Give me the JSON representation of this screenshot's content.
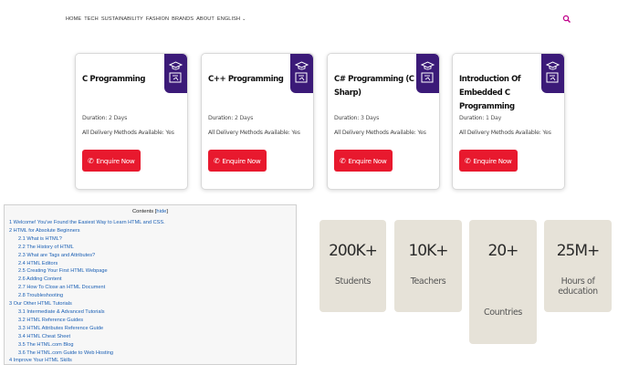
{
  "nav": {
    "items": [
      "HOME",
      "TECH",
      "SUSTAINABILITY",
      "FASHION",
      "BRANDS",
      "ABOUT",
      "ENGLISH"
    ],
    "search_icon": "search-icon",
    "accent": "#c0008a"
  },
  "courses": [
    {
      "title": "C Programming",
      "duration_label": "Duration:",
      "duration": "2 Days",
      "delivery_label": "All Delivery Methods Available:",
      "delivery": "Yes",
      "button": "Enquire Now"
    },
    {
      "title": "C++ Programming",
      "duration_label": "Duration:",
      "duration": "2 Days",
      "delivery_label": "All Delivery Methods Available:",
      "delivery": "Yes",
      "button": "Enquire Now"
    },
    {
      "title": "C# Programming (C Sharp)",
      "duration_label": "Duration:",
      "duration": "3 Days",
      "delivery_label": "All Delivery Methods Available:",
      "delivery": "Yes",
      "button": "Enquire Now"
    },
    {
      "title": "Introduction Of Embedded C Programming",
      "duration_label": "Duration:",
      "duration": "1 Day",
      "delivery_label": "All Delivery Methods Available:",
      "delivery": "Yes",
      "button": "Enquire Now"
    }
  ],
  "colors": {
    "badge": "#3b1a78",
    "button": "#e8192e",
    "stat_bg": "#e6e2d8",
    "toc_link": "#1a5fb4"
  },
  "toc": {
    "title": "Contents",
    "hide": "hide",
    "items": [
      {
        "level": 1,
        "text": "1 Welcome! You've Found the Easiest Way to Learn HTML and CSS."
      },
      {
        "level": 1,
        "text": "2 HTML for Absolute Beginners"
      },
      {
        "level": 2,
        "text": "2.1 What is HTML?"
      },
      {
        "level": 2,
        "text": "2.2 The History of HTML"
      },
      {
        "level": 2,
        "text": "2.3 What are Tags and Attributes?"
      },
      {
        "level": 2,
        "text": "2.4 HTML Editors"
      },
      {
        "level": 2,
        "text": "2.5 Creating Your First HTML Webpage"
      },
      {
        "level": 2,
        "text": "2.6 Adding Content"
      },
      {
        "level": 2,
        "text": "2.7 How To Close an HTML Document"
      },
      {
        "level": 2,
        "text": "2.8 Troubleshooting"
      },
      {
        "level": 1,
        "text": "3 Our Other HTML Tutorials"
      },
      {
        "level": 2,
        "text": "3.1 Intermediate & Advanced Tutorials"
      },
      {
        "level": 2,
        "text": "3.2 HTML Reference Guides"
      },
      {
        "level": 2,
        "text": "3.3 HTML Attributes Reference Guide"
      },
      {
        "level": 2,
        "text": "3.4 HTML Cheat Sheet"
      },
      {
        "level": 2,
        "text": "3.5 The HTML.com Blog"
      },
      {
        "level": 2,
        "text": "3.6 The HTML.com Guide to Web Hosting"
      },
      {
        "level": 1,
        "text": "4 Improve Your HTML Skills"
      }
    ]
  },
  "stats": [
    {
      "value": "200K+",
      "label": "Students"
    },
    {
      "value": "10K+",
      "label": "Teachers"
    },
    {
      "value": "20+",
      "label": "Countries"
    },
    {
      "value": "25M+",
      "label": "Hours of education"
    }
  ]
}
